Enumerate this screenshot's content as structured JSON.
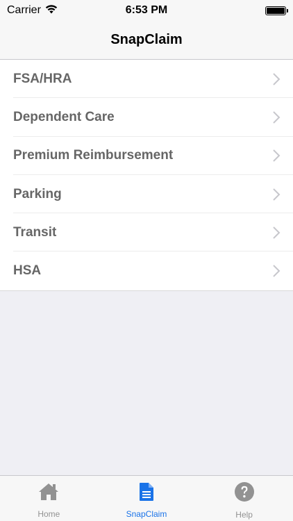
{
  "status_bar": {
    "carrier": "Carrier",
    "time": "6:53 PM",
    "battery_level": 1.0
  },
  "nav": {
    "title": "SnapClaim"
  },
  "list": {
    "items": [
      {
        "label": "FSA/HRA"
      },
      {
        "label": "Dependent Care"
      },
      {
        "label": "Premium Reimbursement"
      },
      {
        "label": "Parking"
      },
      {
        "label": "Transit"
      },
      {
        "label": "HSA"
      }
    ]
  },
  "tab_bar": {
    "tabs": [
      {
        "label": "Home",
        "icon": "home-icon",
        "active": false
      },
      {
        "label": "SnapClaim",
        "icon": "document-icon",
        "active": true
      },
      {
        "label": "Help",
        "icon": "help-icon",
        "active": false
      }
    ]
  },
  "colors": {
    "accent": "#1a73e8",
    "inactive": "#929292",
    "label": "#666666"
  }
}
